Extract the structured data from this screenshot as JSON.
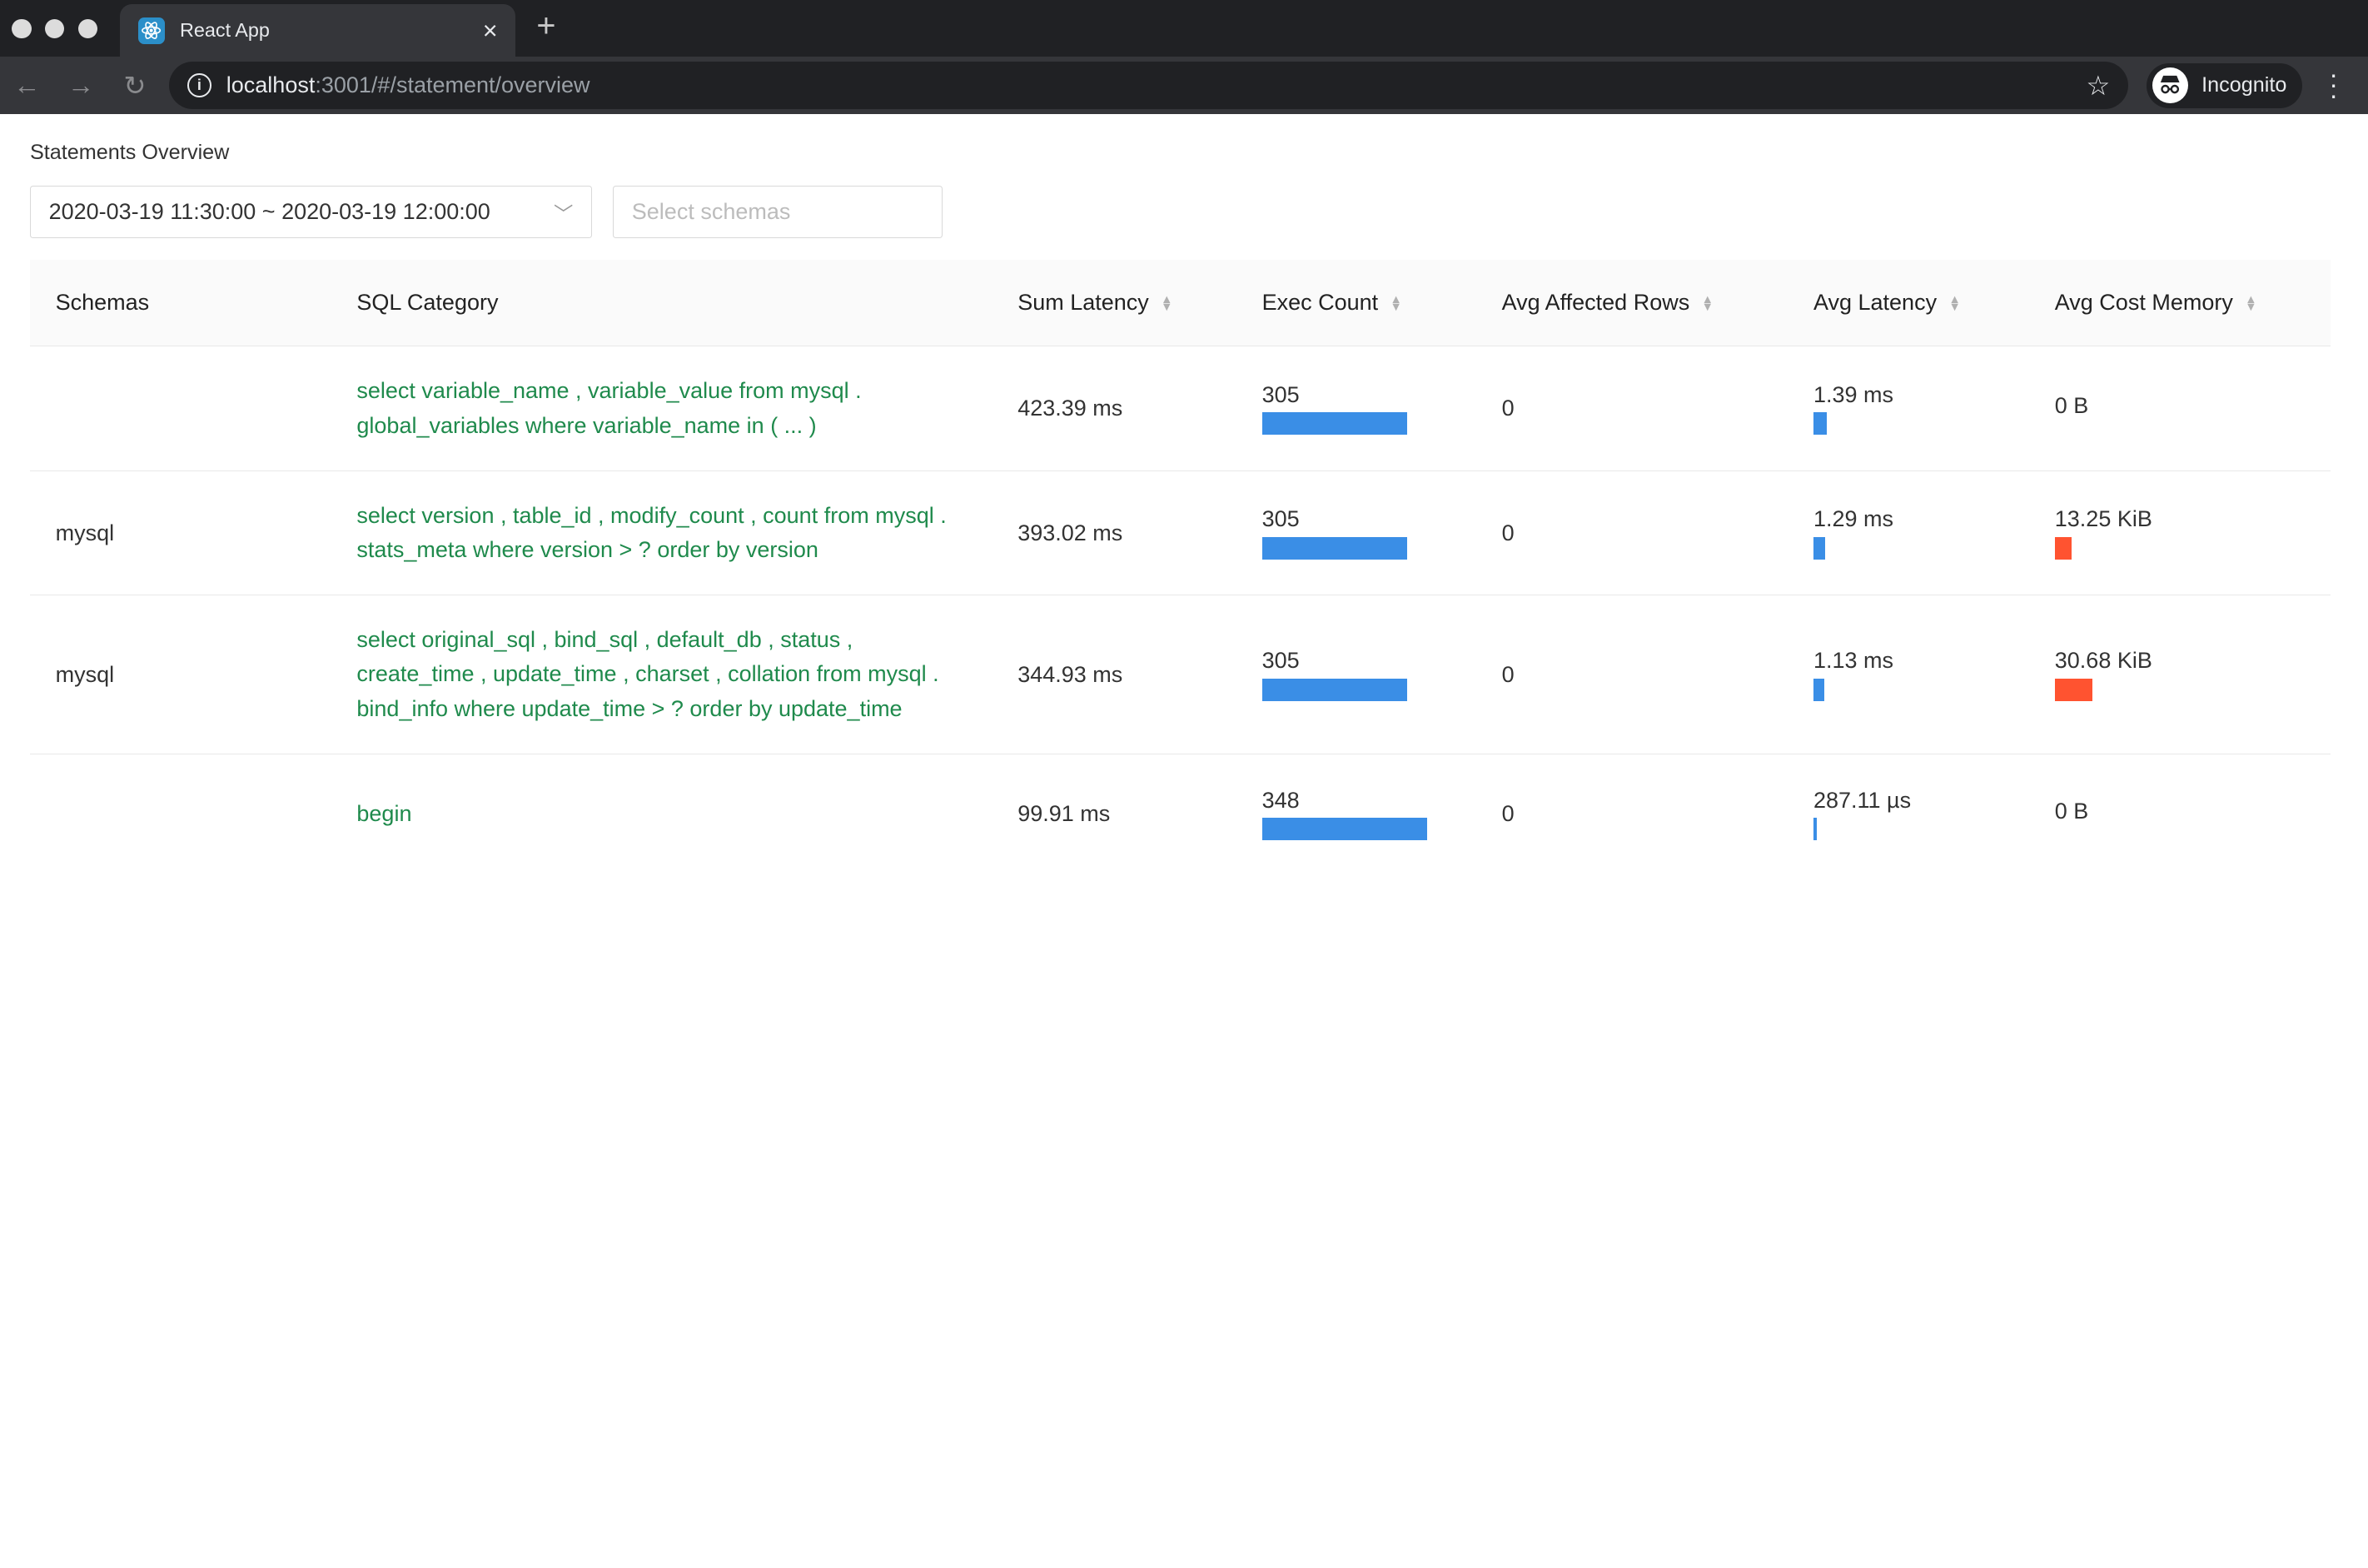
{
  "browser": {
    "tab_title": "React App",
    "tab_close": "×",
    "new_tab": "+",
    "url_host": "localhost",
    "url_path": ":3001/#/statement/overview",
    "profile_label": "Incognito"
  },
  "page": {
    "title": "Statements Overview",
    "time_range": "2020-03-19 11:30:00 ~ 2020-03-19 12:00:00",
    "schemas_placeholder": "Select schemas"
  },
  "table": {
    "columns": [
      "Schemas",
      "SQL Category",
      "Sum Latency",
      "Exec Count",
      "Avg Affected Rows",
      "Avg Latency",
      "Avg Cost Memory"
    ],
    "rows": [
      {
        "schema": "",
        "sql": "select variable_name , variable_value from mysql . global_variables where variable_name in ( ... )",
        "sum_latency": "423.39 ms",
        "exec_count": "305",
        "exec_count_frac": 0.88,
        "avg_affected_rows": "0",
        "avg_latency": "1.39 ms",
        "avg_latency_frac": 0.08,
        "avg_cost_memory": "0 B",
        "avg_cost_memory_frac": 0
      },
      {
        "schema": "mysql",
        "sql": "select version , table_id , modify_count , count from mysql . stats_meta where version > ? order by version",
        "sum_latency": "393.02 ms",
        "exec_count": "305",
        "exec_count_frac": 0.88,
        "avg_affected_rows": "0",
        "avg_latency": "1.29 ms",
        "avg_latency_frac": 0.07,
        "avg_cost_memory": "13.25 KiB",
        "avg_cost_memory_frac": 0.1
      },
      {
        "schema": "mysql",
        "sql": "select original_sql , bind_sql , default_db , status , create_time , update_time , charset , collation from mysql . bind_info where update_time > ? order by update_time",
        "sum_latency": "344.93 ms",
        "exec_count": "305",
        "exec_count_frac": 0.88,
        "avg_affected_rows": "0",
        "avg_latency": "1.13 ms",
        "avg_latency_frac": 0.06,
        "avg_cost_memory": "30.68 KiB",
        "avg_cost_memory_frac": 0.23
      },
      {
        "schema": "",
        "sql": "begin",
        "sum_latency": "99.91 ms",
        "exec_count": "348",
        "exec_count_frac": 1.0,
        "avg_affected_rows": "0",
        "avg_latency": "287.11 µs",
        "avg_latency_frac": 0.015,
        "avg_cost_memory": "0 B",
        "avg_cost_memory_frac": 0
      }
    ]
  },
  "colors": {
    "bar_blue": "#3a8ee6",
    "bar_red": "#ff5330",
    "sql_green": "#1f8a4c"
  }
}
